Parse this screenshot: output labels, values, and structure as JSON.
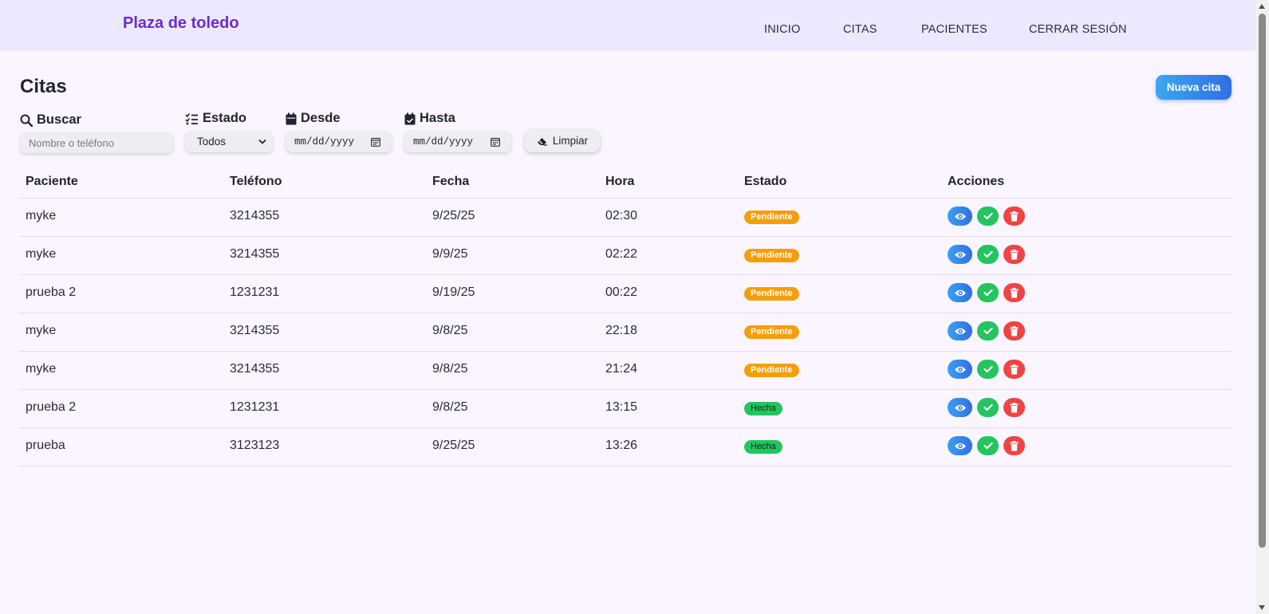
{
  "header": {
    "brand": "Plaza de toledo",
    "nav": [
      "INICIO",
      "CITAS",
      "PACIENTES",
      "CERRAR SESIÓN"
    ]
  },
  "page": {
    "title": "Citas",
    "new_button": "Nueva cita"
  },
  "filters": {
    "search_label": "Buscar",
    "search_placeholder": "Nombre o teléfono",
    "status_label": "Estado",
    "status_value": "Todos",
    "from_label": "Desde",
    "from_placeholder": "mm/dd/yyyy",
    "to_label": "Hasta",
    "to_placeholder": "mm/dd/yyyy",
    "clear_button": "Limpiar"
  },
  "table": {
    "columns": [
      "Paciente",
      "Teléfono",
      "Fecha",
      "Hora",
      "Estado",
      "Acciones"
    ],
    "rows": [
      {
        "patient": "myke",
        "phone": "3214355",
        "date": "9/25/25",
        "time": "02:30",
        "status": "Pendiente"
      },
      {
        "patient": "myke",
        "phone": "3214355",
        "date": "9/9/25",
        "time": "02:22",
        "status": "Pendiente"
      },
      {
        "patient": "prueba 2",
        "phone": "1231231",
        "date": "9/19/25",
        "time": "00:22",
        "status": "Pendiente"
      },
      {
        "patient": "myke",
        "phone": "3214355",
        "date": "9/8/25",
        "time": "22:18",
        "status": "Pendiente"
      },
      {
        "patient": "myke",
        "phone": "3214355",
        "date": "9/8/25",
        "time": "21:24",
        "status": "Pendiente"
      },
      {
        "patient": "prueba 2",
        "phone": "1231231",
        "date": "9/8/25",
        "time": "13:15",
        "status": "Hecha"
      },
      {
        "patient": "prueba",
        "phone": "3123123",
        "date": "9/25/25",
        "time": "13:26",
        "status": "Hecha"
      }
    ]
  },
  "colors": {
    "brand": "#6d2ad3",
    "header_bg": "#ece8fd",
    "page_bg": "#faf5fe",
    "pending": "#f59e0b",
    "done": "#22c55e",
    "view": "#2f6fe4",
    "delete": "#ef4444"
  }
}
